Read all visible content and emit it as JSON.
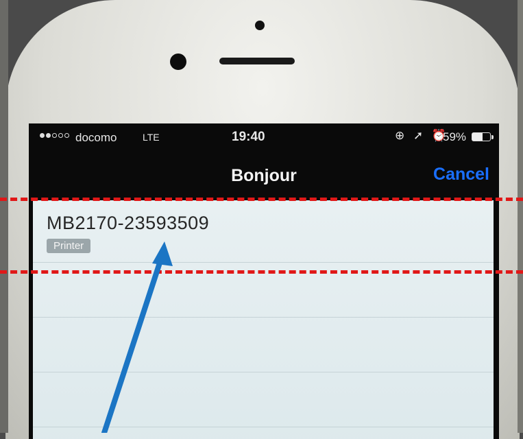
{
  "status_bar": {
    "carrier": "docomo",
    "network": "LTE",
    "time": "19:40",
    "status_icons": "⊕ ➚ ⏰",
    "battery": "59%",
    "battery_level": 0.59
  },
  "nav": {
    "title": "Bonjour",
    "cancel_label": "Cancel"
  },
  "devices": [
    {
      "name": "MB2170-23593509",
      "type": "Printer"
    }
  ],
  "colors": {
    "annotation_lines": "#e01818",
    "annotation_arrow": "#1b75c4",
    "accent": "#1a6fff"
  }
}
